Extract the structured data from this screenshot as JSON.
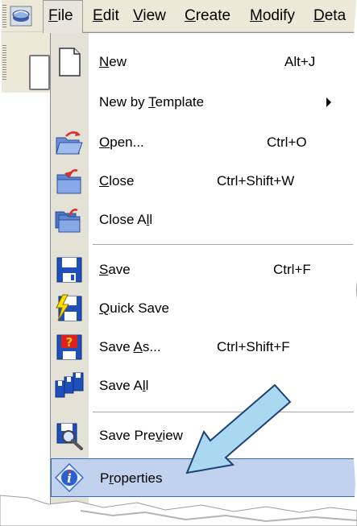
{
  "menubar": {
    "app_icon": "app-logo-icon",
    "menus": [
      {
        "label_pre": "",
        "label_ul": "F",
        "label_post": "ile"
      },
      {
        "label_pre": "",
        "label_ul": "E",
        "label_post": "dit"
      },
      {
        "label_pre": "",
        "label_ul": "V",
        "label_post": "iew"
      },
      {
        "label_pre": "",
        "label_ul": "C",
        "label_post": "reate"
      },
      {
        "label_pre": "",
        "label_ul": "M",
        "label_post": "odify"
      },
      {
        "label_pre": "",
        "label_ul": "D",
        "label_post": "eta"
      }
    ]
  },
  "file_menu": {
    "items": [
      {
        "pre": "",
        "ul": "N",
        "post": "ew",
        "shortcut": "Alt+J",
        "icon": "new-document-icon"
      },
      {
        "pre": "New by ",
        "ul": "T",
        "post": "emplate",
        "shortcut": "",
        "icon": "",
        "submenu": true
      },
      {
        "pre": "",
        "ul": "O",
        "post": "pen...",
        "shortcut": "Ctrl+O",
        "icon": "open-folder-icon"
      },
      {
        "pre": "",
        "ul": "C",
        "post": "lose",
        "shortcut": "Ctrl+Shift+W",
        "icon": "close-folder-icon"
      },
      {
        "pre": "Close A",
        "ul": "l",
        "post": "l",
        "shortcut": "",
        "icon": "close-all-icon"
      },
      {
        "pre": "",
        "ul": "S",
        "post": "ave",
        "shortcut": "Ctrl+F",
        "icon": "save-disk-icon"
      },
      {
        "pre": "",
        "ul": "Q",
        "post": "uick Save",
        "shortcut": "",
        "icon": "quick-save-icon"
      },
      {
        "pre": "Save ",
        "ul": "A",
        "post": "s...",
        "shortcut": "Ctrl+Shift+F",
        "icon": "save-as-icon"
      },
      {
        "pre": "Save A",
        "ul": "l",
        "post": "l",
        "shortcut": "",
        "icon": "save-all-icon"
      },
      {
        "pre": "Save Pre",
        "ul": "v",
        "post": "iew",
        "shortcut": "",
        "icon": "save-preview-icon"
      },
      {
        "pre": "P",
        "ul": "r",
        "post": "operties",
        "shortcut": "",
        "icon": "properties-info-icon",
        "highlighted": true
      }
    ]
  },
  "annotation": {
    "arrow_icon": "callout-arrow-icon",
    "arrow_color": "#a9d8f0",
    "highlight_color": "#c1d2ee"
  }
}
